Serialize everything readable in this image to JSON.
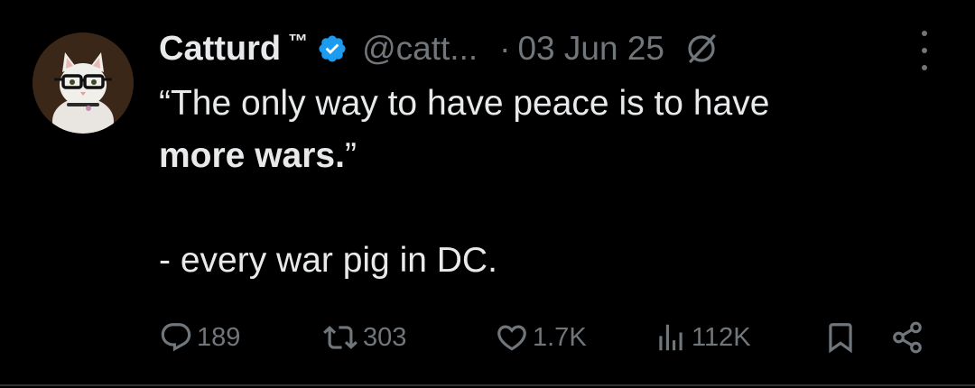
{
  "tweet": {
    "display_name": "Catturd",
    "trademark": "™",
    "handle": "@catt...",
    "separator": "·",
    "date": "03 Jun 25",
    "verified_color": "#1d9bf0",
    "icons": {
      "avatar": "cat-with-glasses-avatar",
      "verified": "verified-badge-icon",
      "grok": "grok-icon",
      "more": "more-options-icon"
    },
    "body": {
      "line1": "“The only way to have peace is to have",
      "line2_bold": "more wars.",
      "line2_rest": "”",
      "line3": "- every war pig in DC."
    },
    "actions": {
      "reply": {
        "icon": "reply-icon",
        "count": "189"
      },
      "retweet": {
        "icon": "retweet-icon",
        "count": "303"
      },
      "like": {
        "icon": "heart-icon",
        "count": "1.7K"
      },
      "views": {
        "icon": "views-icon",
        "count": "112K"
      },
      "bookmark": {
        "icon": "bookmark-icon"
      },
      "share": {
        "icon": "share-icon"
      }
    }
  },
  "colors": {
    "background": "#000000",
    "primary_text": "#e7e9ea",
    "secondary_text": "#71767b",
    "divider": "#2f3336"
  }
}
